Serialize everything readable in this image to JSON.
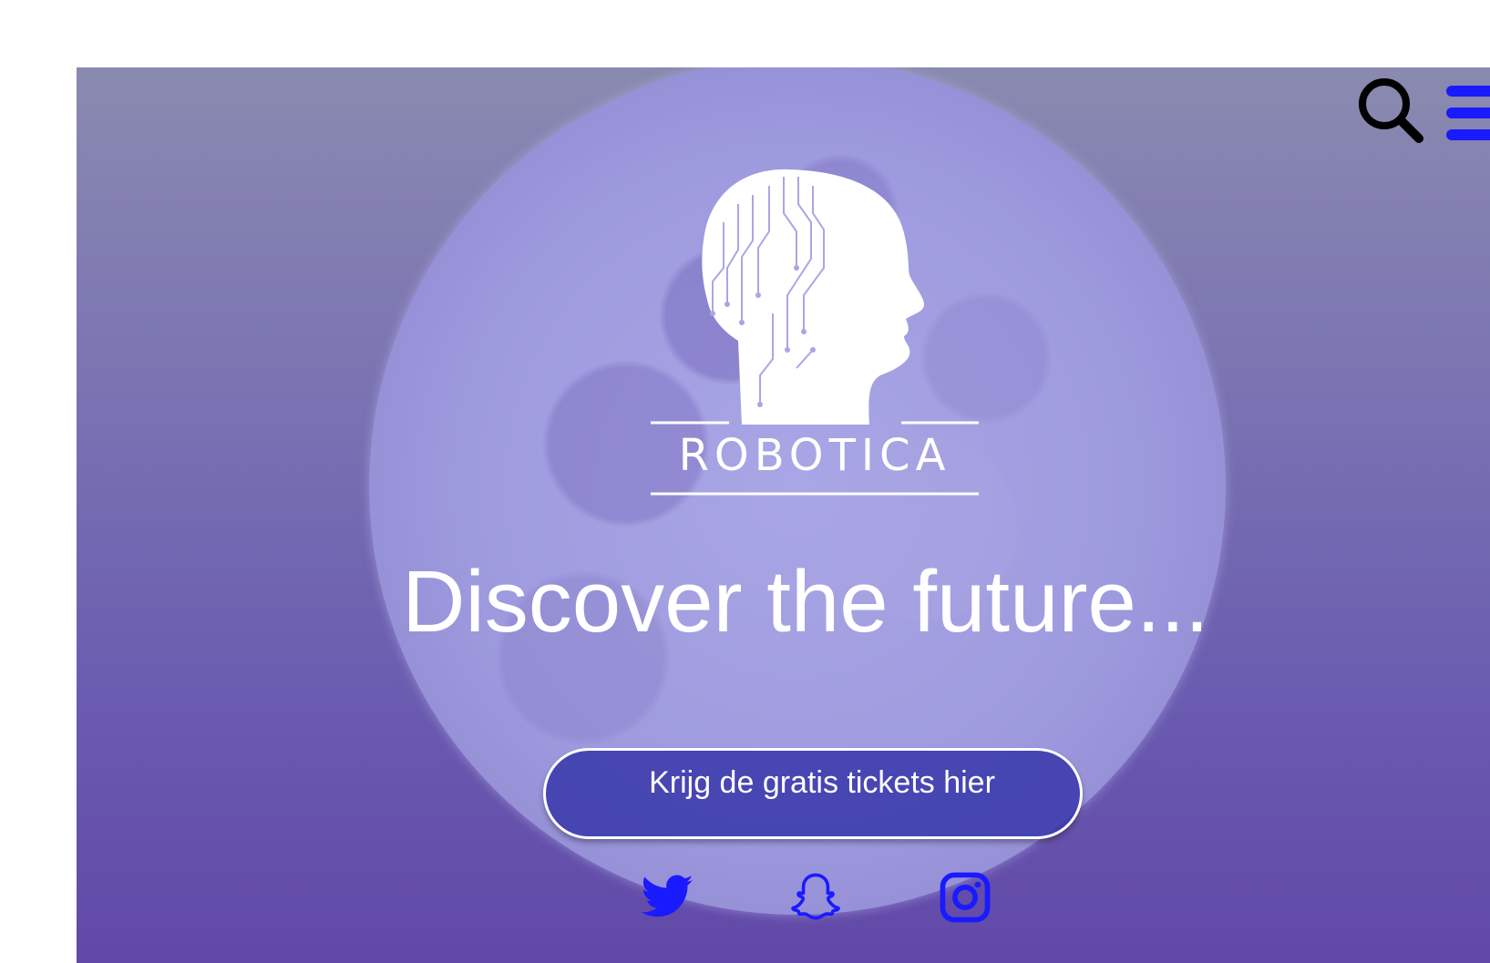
{
  "brand": {
    "name": "ROBOTICA",
    "logo_icon": "circuit-head-logo"
  },
  "hero": {
    "tagline": "Discover the future...",
    "cta_label": "Krijg de gratis tickets hier"
  },
  "header": {
    "search_icon": "search-icon",
    "menu_icon": "hamburger-menu-icon"
  },
  "social": [
    {
      "name": "twitter",
      "icon": "twitter-icon"
    },
    {
      "name": "snapchat",
      "icon": "snapchat-icon"
    },
    {
      "name": "instagram",
      "icon": "instagram-icon"
    }
  ],
  "colors": {
    "accent": "#1a1aff",
    "background_top": "#8a8ab0",
    "background_bottom": "#6148a8",
    "moon": "#a9a6e6",
    "button": "#3737aa",
    "text": "#ffffff"
  }
}
